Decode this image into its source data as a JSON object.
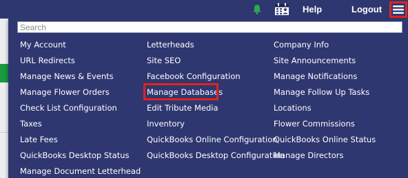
{
  "topbar": {
    "icons": [
      "bell-icon",
      "calendar-icon"
    ],
    "help_label": "Help",
    "logout_label": "Logout",
    "menu_icon": "hamburger-menu-icon",
    "highlight_color": "#e2231a",
    "bell_color": "#2fa84f"
  },
  "colors": {
    "nav_background": "#2e3770",
    "text": "#ffffff"
  },
  "dropdown": {
    "search": {
      "placeholder": "Search",
      "value": ""
    },
    "columns": [
      {
        "items": [
          {
            "label": "My Account"
          },
          {
            "label": "URL Redirects"
          },
          {
            "label": "Manage News & Events"
          },
          {
            "label": "Manage Flower Orders"
          },
          {
            "label": "Check List Configuration"
          },
          {
            "label": "Taxes"
          },
          {
            "label": "Late Fees"
          },
          {
            "label": "QuickBooks Desktop Status"
          },
          {
            "label": "Manage Document Letterhead"
          }
        ]
      },
      {
        "items": [
          {
            "label": "Letterheads"
          },
          {
            "label": "Site SEO"
          },
          {
            "label": "Facebook Configuration"
          },
          {
            "label": "Manage Databases",
            "highlighted": true
          },
          {
            "label": "Edit Tribute Media"
          },
          {
            "label": "Inventory"
          },
          {
            "label": "QuickBooks Online Configuration"
          },
          {
            "label": "QuickBooks Desktop Configuration"
          }
        ]
      },
      {
        "items": [
          {
            "label": "Company Info"
          },
          {
            "label": "Site Announcements"
          },
          {
            "label": "Manage Notifications"
          },
          {
            "label": "Manage Follow Up Tasks"
          },
          {
            "label": "Locations"
          },
          {
            "label": "Flower Commissions"
          },
          {
            "label": "QuickBooks Online Status"
          },
          {
            "label": "Manage Directors"
          }
        ]
      }
    ]
  }
}
